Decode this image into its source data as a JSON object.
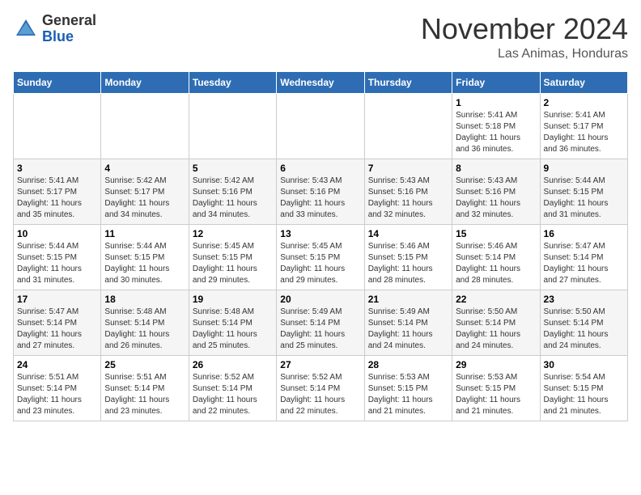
{
  "header": {
    "logo": {
      "general": "General",
      "blue": "Blue"
    },
    "title": "November 2024",
    "location": "Las Animas, Honduras"
  },
  "calendar": {
    "days_of_week": [
      "Sunday",
      "Monday",
      "Tuesday",
      "Wednesday",
      "Thursday",
      "Friday",
      "Saturday"
    ],
    "weeks": [
      [
        {
          "day": "",
          "info": ""
        },
        {
          "day": "",
          "info": ""
        },
        {
          "day": "",
          "info": ""
        },
        {
          "day": "",
          "info": ""
        },
        {
          "day": "",
          "info": ""
        },
        {
          "day": "1",
          "info": "Sunrise: 5:41 AM\nSunset: 5:18 PM\nDaylight: 11 hours\nand 36 minutes."
        },
        {
          "day": "2",
          "info": "Sunrise: 5:41 AM\nSunset: 5:17 PM\nDaylight: 11 hours\nand 36 minutes."
        }
      ],
      [
        {
          "day": "3",
          "info": "Sunrise: 5:41 AM\nSunset: 5:17 PM\nDaylight: 11 hours\nand 35 minutes."
        },
        {
          "day": "4",
          "info": "Sunrise: 5:42 AM\nSunset: 5:17 PM\nDaylight: 11 hours\nand 34 minutes."
        },
        {
          "day": "5",
          "info": "Sunrise: 5:42 AM\nSunset: 5:16 PM\nDaylight: 11 hours\nand 34 minutes."
        },
        {
          "day": "6",
          "info": "Sunrise: 5:43 AM\nSunset: 5:16 PM\nDaylight: 11 hours\nand 33 minutes."
        },
        {
          "day": "7",
          "info": "Sunrise: 5:43 AM\nSunset: 5:16 PM\nDaylight: 11 hours\nand 32 minutes."
        },
        {
          "day": "8",
          "info": "Sunrise: 5:43 AM\nSunset: 5:16 PM\nDaylight: 11 hours\nand 32 minutes."
        },
        {
          "day": "9",
          "info": "Sunrise: 5:44 AM\nSunset: 5:15 PM\nDaylight: 11 hours\nand 31 minutes."
        }
      ],
      [
        {
          "day": "10",
          "info": "Sunrise: 5:44 AM\nSunset: 5:15 PM\nDaylight: 11 hours\nand 31 minutes."
        },
        {
          "day": "11",
          "info": "Sunrise: 5:44 AM\nSunset: 5:15 PM\nDaylight: 11 hours\nand 30 minutes."
        },
        {
          "day": "12",
          "info": "Sunrise: 5:45 AM\nSunset: 5:15 PM\nDaylight: 11 hours\nand 29 minutes."
        },
        {
          "day": "13",
          "info": "Sunrise: 5:45 AM\nSunset: 5:15 PM\nDaylight: 11 hours\nand 29 minutes."
        },
        {
          "day": "14",
          "info": "Sunrise: 5:46 AM\nSunset: 5:15 PM\nDaylight: 11 hours\nand 28 minutes."
        },
        {
          "day": "15",
          "info": "Sunrise: 5:46 AM\nSunset: 5:14 PM\nDaylight: 11 hours\nand 28 minutes."
        },
        {
          "day": "16",
          "info": "Sunrise: 5:47 AM\nSunset: 5:14 PM\nDaylight: 11 hours\nand 27 minutes."
        }
      ],
      [
        {
          "day": "17",
          "info": "Sunrise: 5:47 AM\nSunset: 5:14 PM\nDaylight: 11 hours\nand 27 minutes."
        },
        {
          "day": "18",
          "info": "Sunrise: 5:48 AM\nSunset: 5:14 PM\nDaylight: 11 hours\nand 26 minutes."
        },
        {
          "day": "19",
          "info": "Sunrise: 5:48 AM\nSunset: 5:14 PM\nDaylight: 11 hours\nand 25 minutes."
        },
        {
          "day": "20",
          "info": "Sunrise: 5:49 AM\nSunset: 5:14 PM\nDaylight: 11 hours\nand 25 minutes."
        },
        {
          "day": "21",
          "info": "Sunrise: 5:49 AM\nSunset: 5:14 PM\nDaylight: 11 hours\nand 24 minutes."
        },
        {
          "day": "22",
          "info": "Sunrise: 5:50 AM\nSunset: 5:14 PM\nDaylight: 11 hours\nand 24 minutes."
        },
        {
          "day": "23",
          "info": "Sunrise: 5:50 AM\nSunset: 5:14 PM\nDaylight: 11 hours\nand 24 minutes."
        }
      ],
      [
        {
          "day": "24",
          "info": "Sunrise: 5:51 AM\nSunset: 5:14 PM\nDaylight: 11 hours\nand 23 minutes."
        },
        {
          "day": "25",
          "info": "Sunrise: 5:51 AM\nSunset: 5:14 PM\nDaylight: 11 hours\nand 23 minutes."
        },
        {
          "day": "26",
          "info": "Sunrise: 5:52 AM\nSunset: 5:14 PM\nDaylight: 11 hours\nand 22 minutes."
        },
        {
          "day": "27",
          "info": "Sunrise: 5:52 AM\nSunset: 5:14 PM\nDaylight: 11 hours\nand 22 minutes."
        },
        {
          "day": "28",
          "info": "Sunrise: 5:53 AM\nSunset: 5:15 PM\nDaylight: 11 hours\nand 21 minutes."
        },
        {
          "day": "29",
          "info": "Sunrise: 5:53 AM\nSunset: 5:15 PM\nDaylight: 11 hours\nand 21 minutes."
        },
        {
          "day": "30",
          "info": "Sunrise: 5:54 AM\nSunset: 5:15 PM\nDaylight: 11 hours\nand 21 minutes."
        }
      ]
    ]
  }
}
